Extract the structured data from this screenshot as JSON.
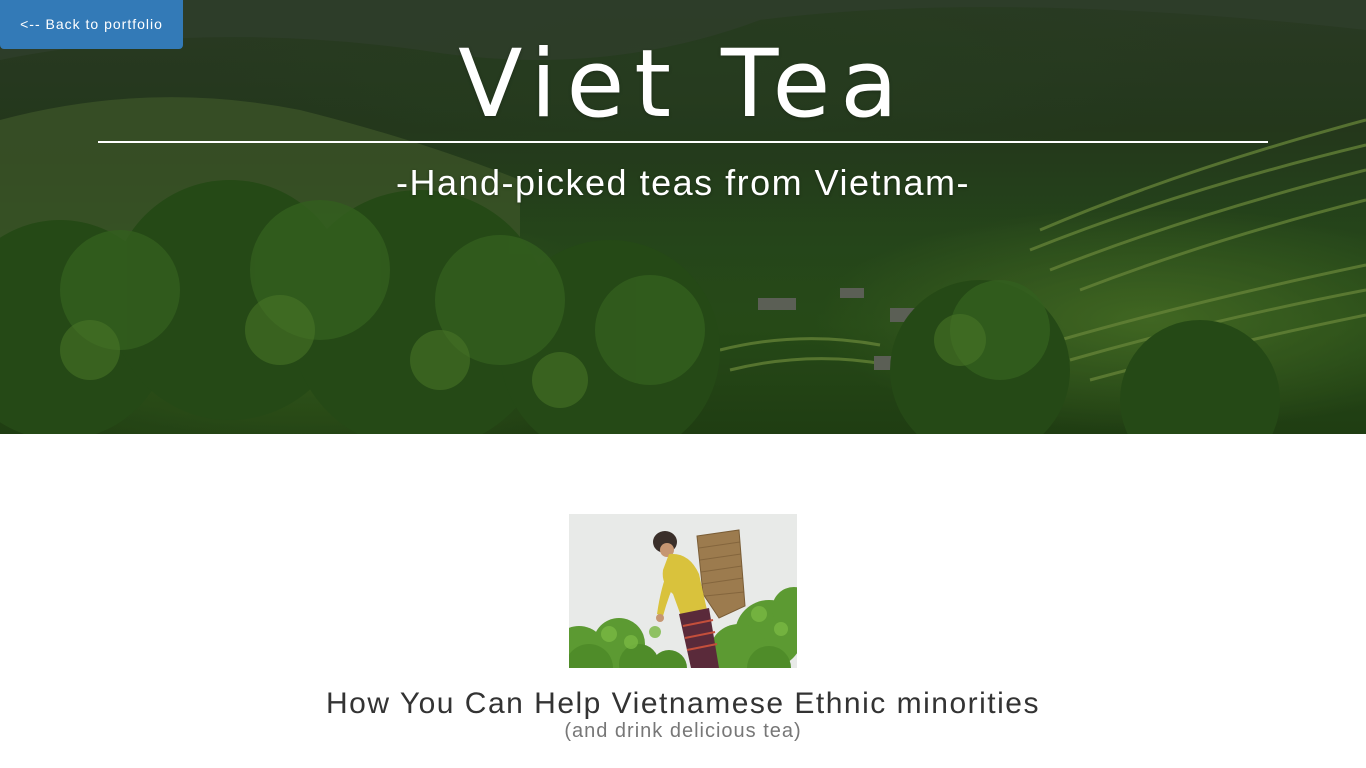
{
  "nav": {
    "back_label": "<-- Back to portfolio"
  },
  "hero": {
    "title": "Viet Tea",
    "subtitle": "-Hand-picked teas from Vietnam-",
    "background": "tea-plantation-hills-photo"
  },
  "feature": {
    "image": "tea-picker-woman-photo",
    "heading": "How You Can Help Vietnamese Ethnic minorities",
    "subheading": "(and drink delicious tea)"
  },
  "colors": {
    "button_bg": "#337ab7",
    "heading_text": "#333333",
    "subheading_text": "#777777"
  }
}
